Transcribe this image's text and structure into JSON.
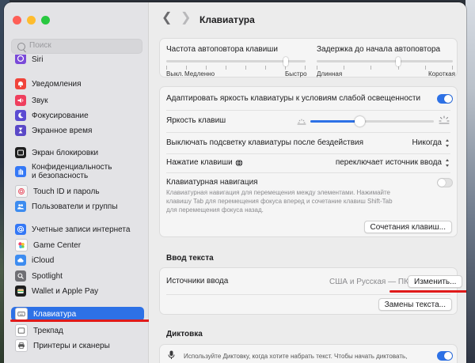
{
  "window": {
    "colors": {
      "close": "#fe5f57",
      "minimize": "#febc2e",
      "zoom": "#28c840",
      "accent": "#2d71e6",
      "annotation": "#e01a1a"
    }
  },
  "sidebar": {
    "search_placeholder": "Поиск",
    "items": [
      {
        "label": "Siri",
        "icon": "siri-icon",
        "color": "#7b4ad9"
      },
      {
        "label": "Уведомления",
        "icon": "bell-icon",
        "color": "#f0443b"
      },
      {
        "label": "Звук",
        "icon": "speaker-icon",
        "color": "#ef3f5e"
      },
      {
        "label": "Фокусирование",
        "icon": "moon-icon",
        "color": "#5b4bd2"
      },
      {
        "label": "Экранное время",
        "icon": "hourglass-icon",
        "color": "#5a48c7"
      },
      {
        "label": "Экран блокировки",
        "icon": "lock-screen-icon",
        "color": "#1f1f1f"
      },
      {
        "label": "Конфиденциальность\nи безопасность",
        "icon": "hand-icon",
        "color": "#3478f6"
      },
      {
        "label": "Touch ID и пароль",
        "icon": "fingerprint-icon",
        "color": "#f6f6f6"
      },
      {
        "label": "Пользователи и группы",
        "icon": "users-icon",
        "color": "#3d8cf0"
      },
      {
        "label": "Учетные записи интернета",
        "icon": "at-icon",
        "color": "#3478f6"
      },
      {
        "label": "Game Center",
        "icon": "game-center-icon",
        "color": "#ffffff"
      },
      {
        "label": "iCloud",
        "icon": "cloud-icon",
        "color": "#3d8cf0"
      },
      {
        "label": "Spotlight",
        "icon": "spotlight-icon",
        "color": "#6f6f74"
      },
      {
        "label": "Wallet и Apple Pay",
        "icon": "wallet-icon",
        "color": "#1f1f1f"
      },
      {
        "label": "Клавиатура",
        "icon": "keyboard-icon",
        "color": "#ffffff"
      },
      {
        "label": "Трекпад",
        "icon": "trackpad-icon",
        "color": "#ffffff"
      },
      {
        "label": "Принтеры и сканеры",
        "icon": "printer-icon",
        "color": "#ffffff"
      }
    ]
  },
  "toolbar": {
    "back": "❮",
    "forward": "❯",
    "title": "Клавиатура"
  },
  "repeat": {
    "rate_label": "Частота автоповтора клавиши",
    "rate_left": "Выкл.",
    "rate_left2": "Медленно",
    "rate_right": "Быстро",
    "rate_ticks": 8,
    "rate_level": 0.857,
    "delay_label": "Задержка до начала автоповтора",
    "delay_left": "Длинная",
    "delay_right": "Короткая",
    "delay_ticks": 6,
    "delay_level": 0.6
  },
  "lighting": {
    "adjust_label": "Адаптировать яркость клавиатуры к условиям слабой освещенности",
    "adjust_on": true,
    "brightness_label": "Яркость клавиш",
    "brightness_level": 0.4,
    "off_label": "Выключать подсветку клавиатуры после бездействия",
    "off_value": "Никогда",
    "globe_label": "Нажатие клавиши",
    "globe_value": "переключает источник ввода",
    "nav_label": "Клавиатурная навигация",
    "nav_desc": "Клавиатурная навигация для перемещения между элементами. Нажимайте клавишу Tab для перемещения фокуса вперед и сочетание клавиш Shift-Tab для перемещения фокуса назад.",
    "nav_on": false,
    "shortcuts_button": "Сочетания клавиш..."
  },
  "text_input": {
    "section": "Ввод текста",
    "sources_label": "Источники ввода",
    "sources_value": "США и Русская — ПК",
    "edit_button": "Изменить...",
    "replacements_button": "Замены текста..."
  },
  "dictation": {
    "section": "Диктовка",
    "desc": "Используйте Диктовку, когда хотите набрать текст. Чтобы начать диктовать,",
    "on": true
  }
}
